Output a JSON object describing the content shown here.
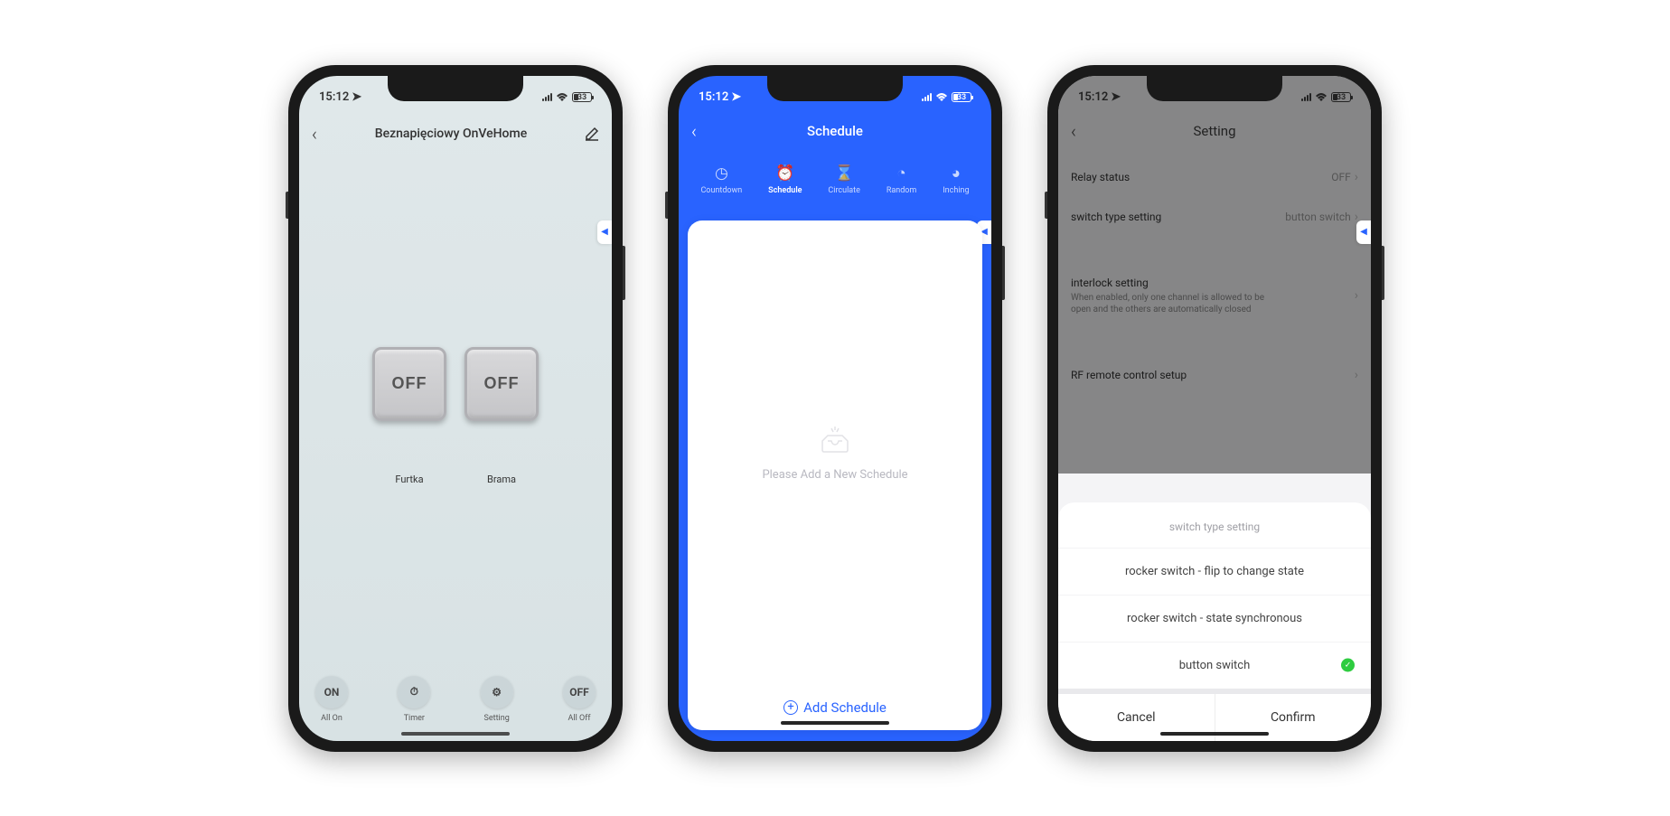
{
  "status": {
    "time": "15:12",
    "battery": "33"
  },
  "screen1": {
    "title": "Beznapięciowy OnVeHome",
    "switches": [
      {
        "state": "OFF",
        "label": "Furtka"
      },
      {
        "state": "OFF",
        "label": "Brama"
      }
    ],
    "bottom": [
      {
        "label": "All On",
        "icon": "ON"
      },
      {
        "label": "Timer",
        "icon": "⏱"
      },
      {
        "label": "Setting",
        "icon": "⚙"
      },
      {
        "label": "All Off",
        "icon": "OFF"
      }
    ]
  },
  "screen2": {
    "title": "Schedule",
    "tabs": [
      {
        "label": "Countdown",
        "icon": "◷"
      },
      {
        "label": "Schedule",
        "icon": "⏰",
        "active": true
      },
      {
        "label": "Circulate",
        "icon": "⌛"
      },
      {
        "label": "Random",
        "icon": "◔"
      },
      {
        "label": "Inching",
        "icon": "◕"
      }
    ],
    "empty_text": "Please Add a New Schedule",
    "add_label": "Add Schedule"
  },
  "screen3": {
    "title": "Setting",
    "rows": [
      {
        "title": "Relay status",
        "value": "OFF"
      },
      {
        "title": "switch type setting",
        "value": "button switch"
      },
      {
        "title": "interlock setting",
        "sub": "When enabled, only one channel is allowed to be open and the others are automatically closed"
      },
      {
        "title": "RF remote control setup"
      }
    ],
    "sheet": {
      "title": "switch type setting",
      "options": [
        {
          "label": "rocker switch - flip to change state",
          "selected": false
        },
        {
          "label": "rocker switch - state synchronous",
          "selected": false
        },
        {
          "label": "button switch",
          "selected": true
        }
      ],
      "cancel": "Cancel",
      "confirm": "Confirm"
    }
  }
}
